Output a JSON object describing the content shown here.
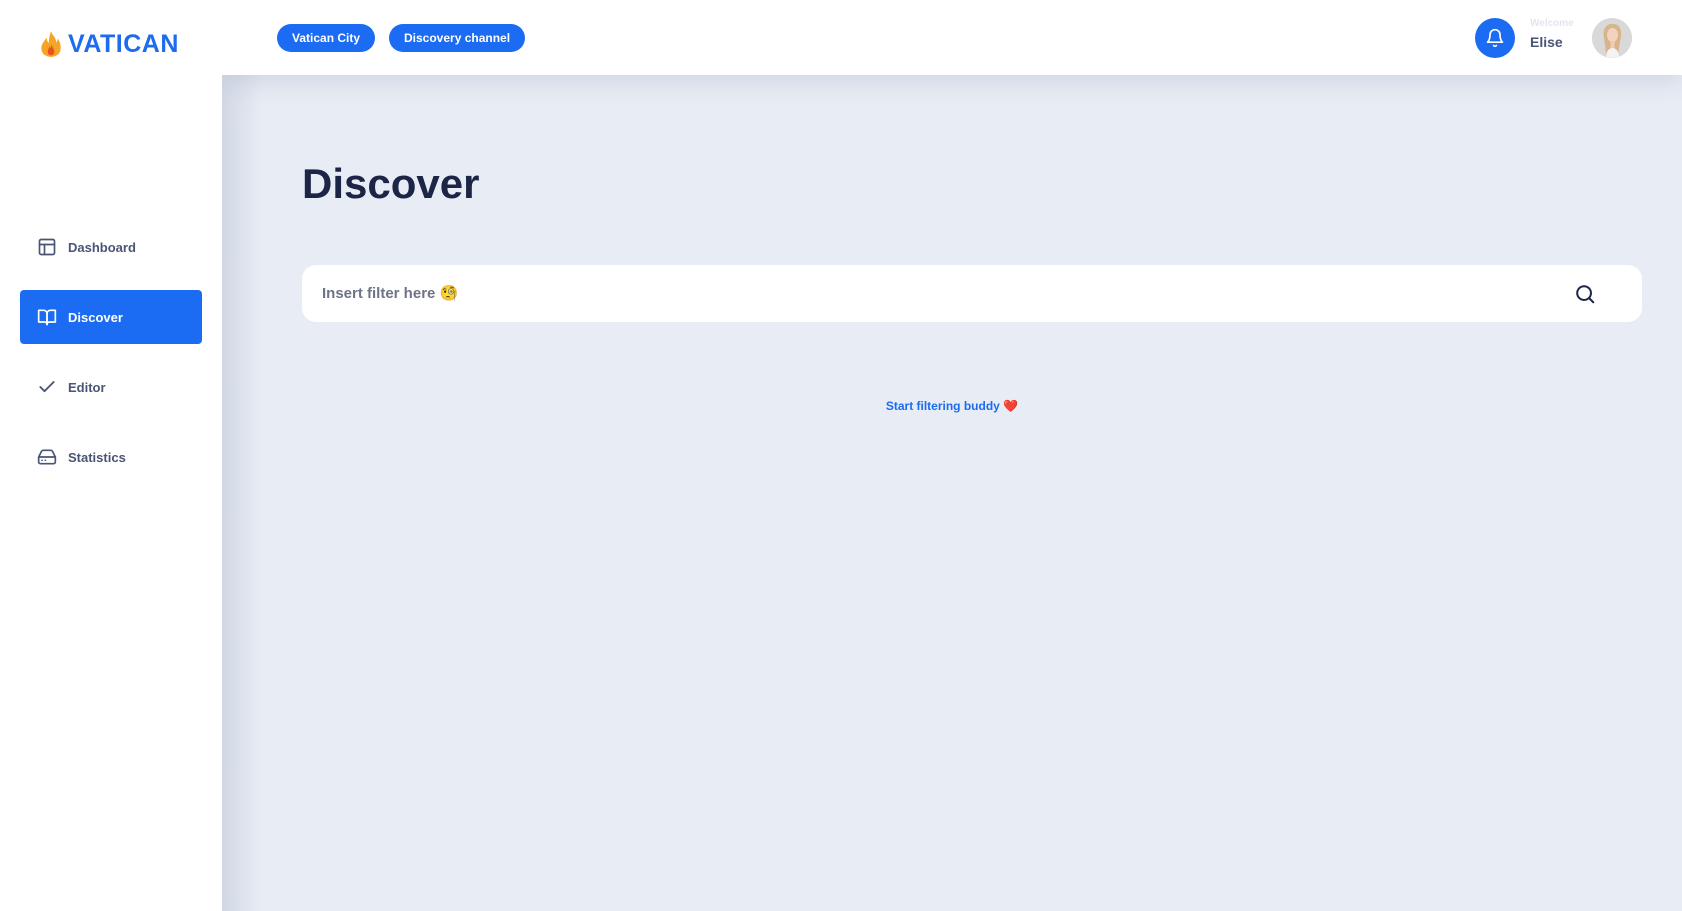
{
  "brand": {
    "name": "VATICAN",
    "icon": "flame-icon"
  },
  "sidebar": {
    "items": [
      {
        "label": "Dashboard",
        "icon": "layout-icon",
        "active": false
      },
      {
        "label": "Discover",
        "icon": "book-open-icon",
        "active": true
      },
      {
        "label": "Editor",
        "icon": "check-icon",
        "active": false
      },
      {
        "label": "Statistics",
        "icon": "hard-drive-icon",
        "active": false
      }
    ]
  },
  "topbar": {
    "pills": [
      "Vatican City",
      "Discovery channel"
    ],
    "notification_icon": "bell-icon",
    "welcome_label": "Welcome",
    "username": "Elise"
  },
  "main": {
    "title": "Discover",
    "search": {
      "placeholder": "Insert filter here 🧐",
      "icon": "search-icon"
    },
    "hint": {
      "text": "Start filtering buddy",
      "emoji": "❤️"
    }
  },
  "colors": {
    "accent": "#1b6cf2",
    "title": "#1c2546",
    "background": "#e8ecf4",
    "heart": "#e0283c",
    "flame": "#f7a325"
  }
}
